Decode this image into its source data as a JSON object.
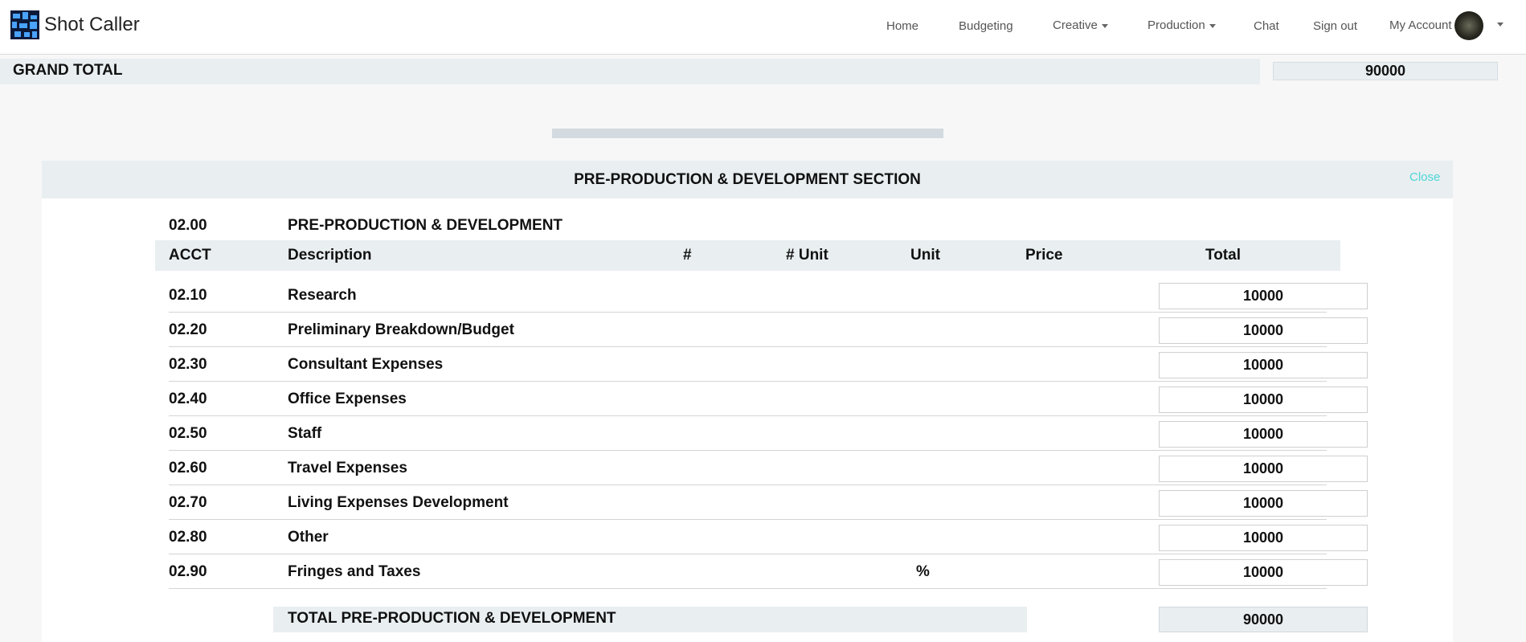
{
  "app": {
    "name": "Shot Caller"
  },
  "nav": {
    "home": "Home",
    "budgeting": "Budgeting",
    "creative": "Creative",
    "production": "Production",
    "chat": "Chat",
    "signout": "Sign out",
    "account": "My Account"
  },
  "grand_total": {
    "label": "GRAND TOTAL",
    "value": "90000"
  },
  "modal": {
    "title": "PRE-PRODUCTION & DEVELOPMENT SECTION",
    "close": "Close",
    "section_number": "02.00",
    "section_name": "PRE-PRODUCTION & DEVELOPMENT",
    "columns": {
      "acct": "ACCT",
      "description": "Description",
      "num": "#",
      "num_unit": "# Unit",
      "unit": "Unit",
      "price": "Price",
      "total": "Total"
    },
    "rows": [
      {
        "acct": "02.10",
        "description": "Research",
        "unit": "",
        "total": "10000"
      },
      {
        "acct": "02.20",
        "description": "Preliminary Breakdown/Budget",
        "unit": "",
        "total": "10000"
      },
      {
        "acct": "02.30",
        "description": "Consultant Expenses",
        "unit": "",
        "total": "10000"
      },
      {
        "acct": "02.40",
        "description": "Office Expenses",
        "unit": "",
        "total": "10000"
      },
      {
        "acct": "02.50",
        "description": "Staff",
        "unit": "",
        "total": "10000"
      },
      {
        "acct": "02.60",
        "description": "Travel Expenses",
        "unit": "",
        "total": "10000"
      },
      {
        "acct": "02.70",
        "description": "Living Expenses Development",
        "unit": "",
        "total": "10000"
      },
      {
        "acct": "02.80",
        "description": "Other",
        "unit": "",
        "total": "10000"
      },
      {
        "acct": "02.90",
        "description": "Fringes and Taxes",
        "unit": "%",
        "total": "10000"
      }
    ],
    "section_total": {
      "label": "TOTAL PRE-PRODUCTION & DEVELOPMENT",
      "value": "90000"
    }
  }
}
